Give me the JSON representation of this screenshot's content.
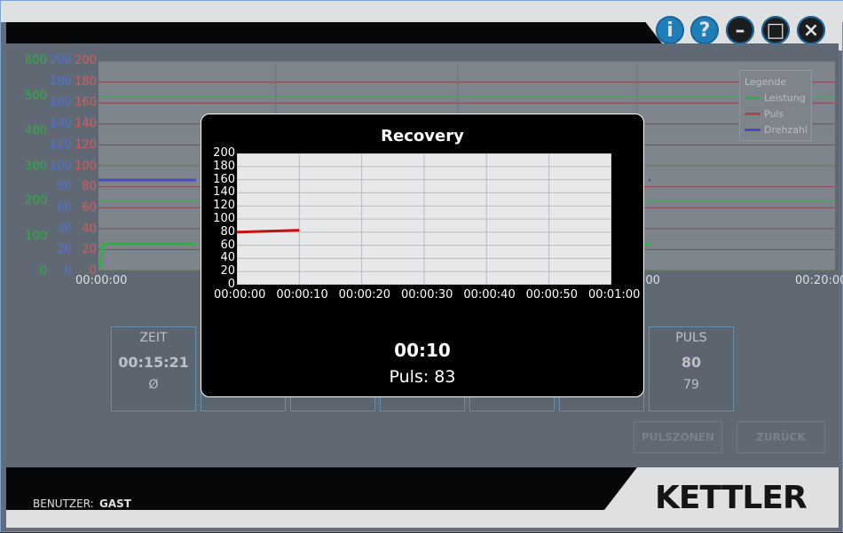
{
  "window": {
    "buttons": {
      "info_label": "i",
      "help_label": "?",
      "minimize_label": "–",
      "maximize_label": "□",
      "close_label": "×"
    }
  },
  "axes": {
    "green": [
      "600",
      "500",
      "400",
      "300",
      "200",
      "100",
      "0"
    ],
    "blue": [
      "200",
      "180",
      "160",
      "140",
      "120",
      "100",
      "80",
      "60",
      "40",
      "20",
      "0"
    ],
    "red": [
      "200",
      "180",
      "160",
      "140",
      "120",
      "100",
      "80",
      "60",
      "40",
      "20",
      "0"
    ]
  },
  "main_chart": {
    "x_labels": [
      "00:00:00",
      "00:20:00"
    ],
    "x_label_partial": ":00",
    "legend": {
      "title": "Legende",
      "items": [
        {
          "label": "Leistung",
          "color": "#38c24a"
        },
        {
          "label": "Puls",
          "color": "#c84a4a"
        },
        {
          "label": "Drehzahl",
          "color": "#4a52d8"
        }
      ]
    }
  },
  "tiles": [
    {
      "title": "ZEIT",
      "value": "00:15:21",
      "sub": "Ø"
    },
    {
      "title": "",
      "value": "",
      "sub": ""
    },
    {
      "title": "",
      "value": "",
      "sub": ""
    },
    {
      "title": "",
      "value": "",
      "sub": ""
    },
    {
      "title": "",
      "value": "",
      "sub": ""
    },
    {
      "title": "",
      "value": "",
      "sub": ""
    },
    {
      "title": "PULS",
      "value": "80",
      "sub": "79"
    }
  ],
  "actions": {
    "pulszonen_label": "PULSZONEN",
    "zurueck_label": "ZURÜCK"
  },
  "footer": {
    "user_label": "BENUTZER:",
    "user_value": "GAST",
    "brand": "KETTLER"
  },
  "modal": {
    "title": "Recovery",
    "y_ticks": [
      "200",
      "180",
      "160",
      "140",
      "120",
      "100",
      "80",
      "60",
      "40",
      "20",
      "0"
    ],
    "x_ticks": [
      "00:00:00",
      "00:00:10",
      "00:00:20",
      "00:00:30",
      "00:00:40",
      "00:00:50",
      "00:01:00"
    ],
    "time": "00:10",
    "puls_text": "Puls: 83"
  },
  "chart_data": {
    "type": "line",
    "title": "Recovery",
    "x": [
      "00:00:00",
      "00:00:10"
    ],
    "ylim": [
      0,
      200
    ],
    "xlim": [
      "00:00:00",
      "00:01:00"
    ],
    "series": [
      {
        "values": [
          80,
          83
        ],
        "color": "#c81010"
      }
    ],
    "grid": true
  }
}
